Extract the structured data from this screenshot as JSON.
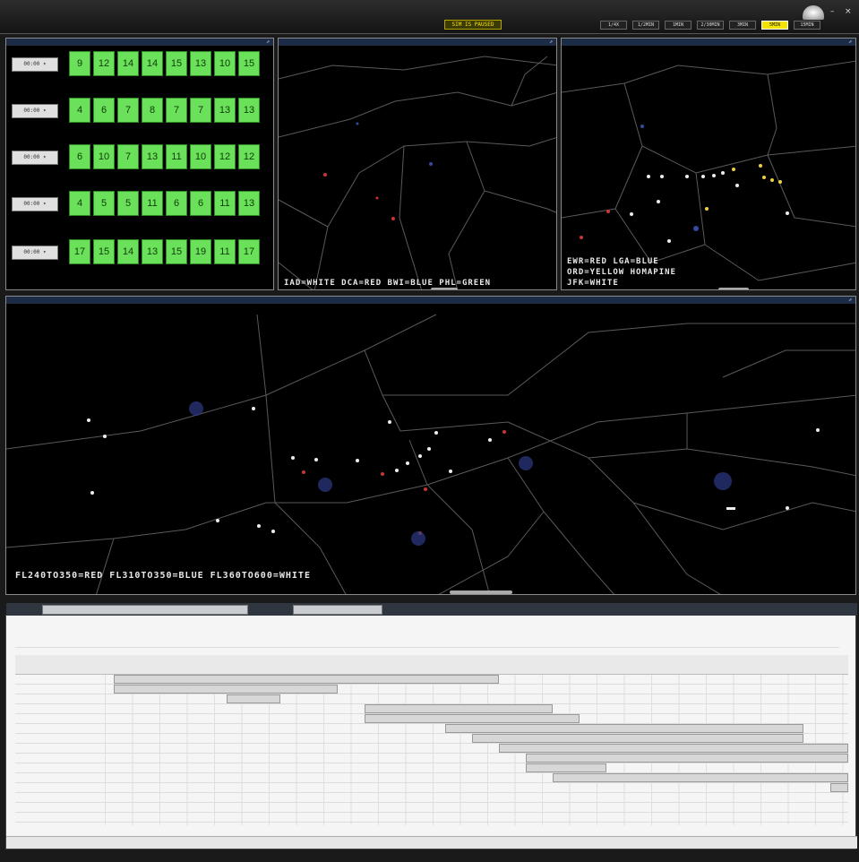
{
  "topbar": {
    "pause_label": "SIM IS PAUSED",
    "time_buttons": [
      "1/4X",
      "1/2MIN",
      "1MIN",
      "2/30MIN",
      "3MIN",
      "5MIN",
      "15MIN"
    ],
    "active_time_button": 5
  },
  "grid_panel": {
    "rows": [
      {
        "label": "00:00 ▾",
        "values": [
          "9",
          "12",
          "14",
          "14",
          "15",
          "13",
          "10",
          "15"
        ]
      },
      {
        "label": "00:00 ▾",
        "values": [
          "4",
          "6",
          "7",
          "8",
          "7",
          "7",
          "13",
          "13"
        ]
      },
      {
        "label": "00:00 ▾",
        "values": [
          "6",
          "10",
          "7",
          "13",
          "11",
          "10",
          "12",
          "12"
        ]
      },
      {
        "label": "00:00 ▾",
        "values": [
          "4",
          "5",
          "5",
          "11",
          "6",
          "6",
          "11",
          "13"
        ]
      },
      {
        "label": "00:00 ▾",
        "values": [
          "17",
          "15",
          "14",
          "13",
          "15",
          "19",
          "11",
          "17"
        ]
      }
    ]
  },
  "map_top_center": {
    "legend": "IAD=WHITE DCA=RED BWI=BLUE PHL=GREEN"
  },
  "map_top_right": {
    "legend_line1": "EWR=RED LGA=BLUE",
    "legend_line2": "ORD=YELLOW HOMAPINE",
    "legend_line3": "JFK=WHITE"
  },
  "map_bottom": {
    "legend": "FL240TO350=RED FL310TO350=BLUE FL360TO600=WHITE"
  },
  "colors": {
    "grid_cell": "#6be05a",
    "map_bg": "#000000",
    "pause": "#f5e000"
  }
}
